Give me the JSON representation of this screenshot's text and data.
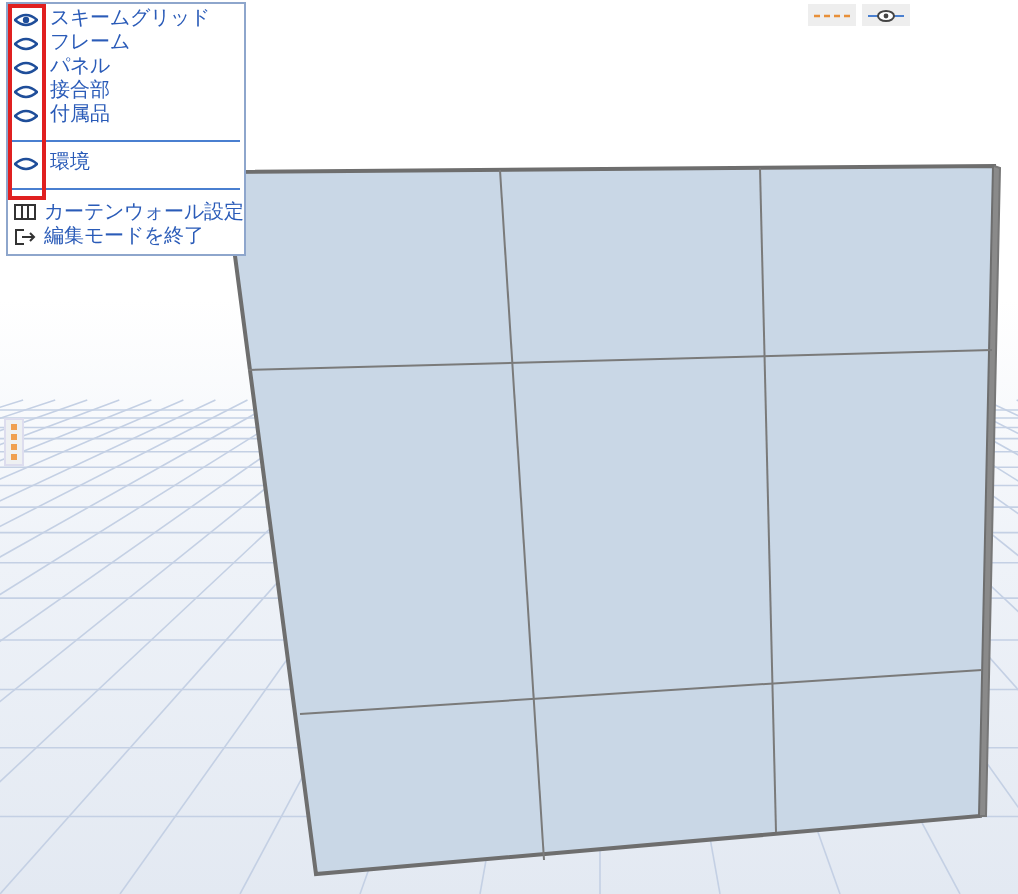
{
  "palette": {
    "layers": [
      {
        "label": "スキームグリッド",
        "visible": true
      },
      {
        "label": "フレーム",
        "visible": false
      },
      {
        "label": "パネル",
        "visible": false
      },
      {
        "label": "接合部",
        "visible": false
      },
      {
        "label": "付属品",
        "visible": false
      }
    ],
    "environment": [
      {
        "label": "環境",
        "visible": false
      }
    ],
    "commands": [
      {
        "label": "カーテンウォール設定",
        "kind": "settings"
      },
      {
        "label": "編集モードを終了",
        "kind": "exit"
      }
    ]
  }
}
